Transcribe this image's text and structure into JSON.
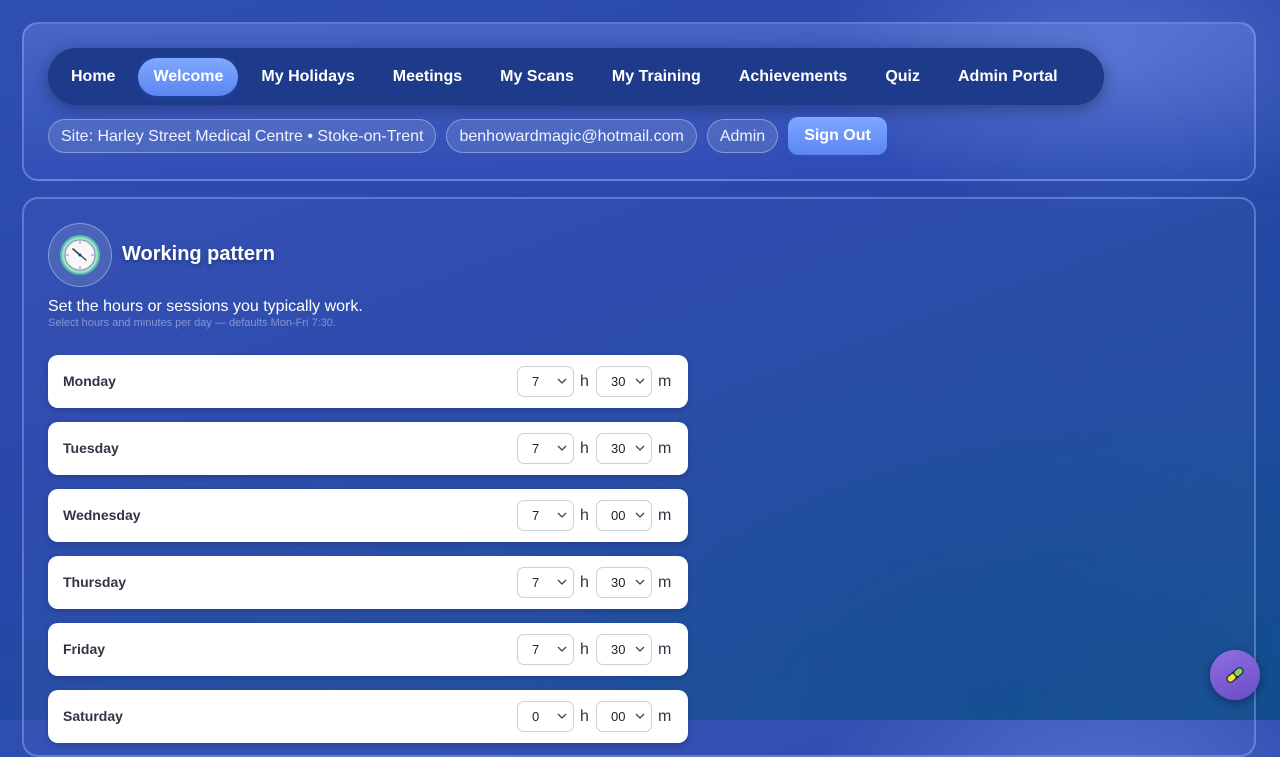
{
  "nav": {
    "items": [
      {
        "label": "Home",
        "active": false
      },
      {
        "label": "Welcome",
        "active": true
      },
      {
        "label": "My Holidays",
        "active": false
      },
      {
        "label": "Meetings",
        "active": false
      },
      {
        "label": "My Scans",
        "active": false
      },
      {
        "label": "My Training",
        "active": false
      },
      {
        "label": "Achievements",
        "active": false
      },
      {
        "label": "Quiz",
        "active": false
      },
      {
        "label": "Admin Portal",
        "active": false
      }
    ]
  },
  "user_bar": {
    "site": "Site: Harley Street Medical Centre • Stoke-on-Trent",
    "email": "benhowardmagic@hotmail.com",
    "role": "Admin",
    "sign_out": "Sign Out"
  },
  "working_pattern": {
    "icon": "clock-icon",
    "title": "Working pattern",
    "description": "Set the hours or sessions you typically work.",
    "hint": "Select hours and minutes per day — defaults Mon-Fri 7:30.",
    "hours_unit": "h",
    "minutes_unit": "m",
    "days": [
      {
        "day": "Monday",
        "hours": "7",
        "minutes": "30"
      },
      {
        "day": "Tuesday",
        "hours": "7",
        "minutes": "30"
      },
      {
        "day": "Wednesday",
        "hours": "7",
        "minutes": "00"
      },
      {
        "day": "Thursday",
        "hours": "7",
        "minutes": "30"
      },
      {
        "day": "Friday",
        "hours": "7",
        "minutes": "30"
      },
      {
        "day": "Saturday",
        "hours": "0",
        "minutes": "00"
      }
    ]
  },
  "fab": {
    "icon": "pill-icon"
  },
  "colors": {
    "accent": "#6d93f7",
    "nav_bg": "#1e3a8a",
    "fab": "#7a5cd4"
  }
}
